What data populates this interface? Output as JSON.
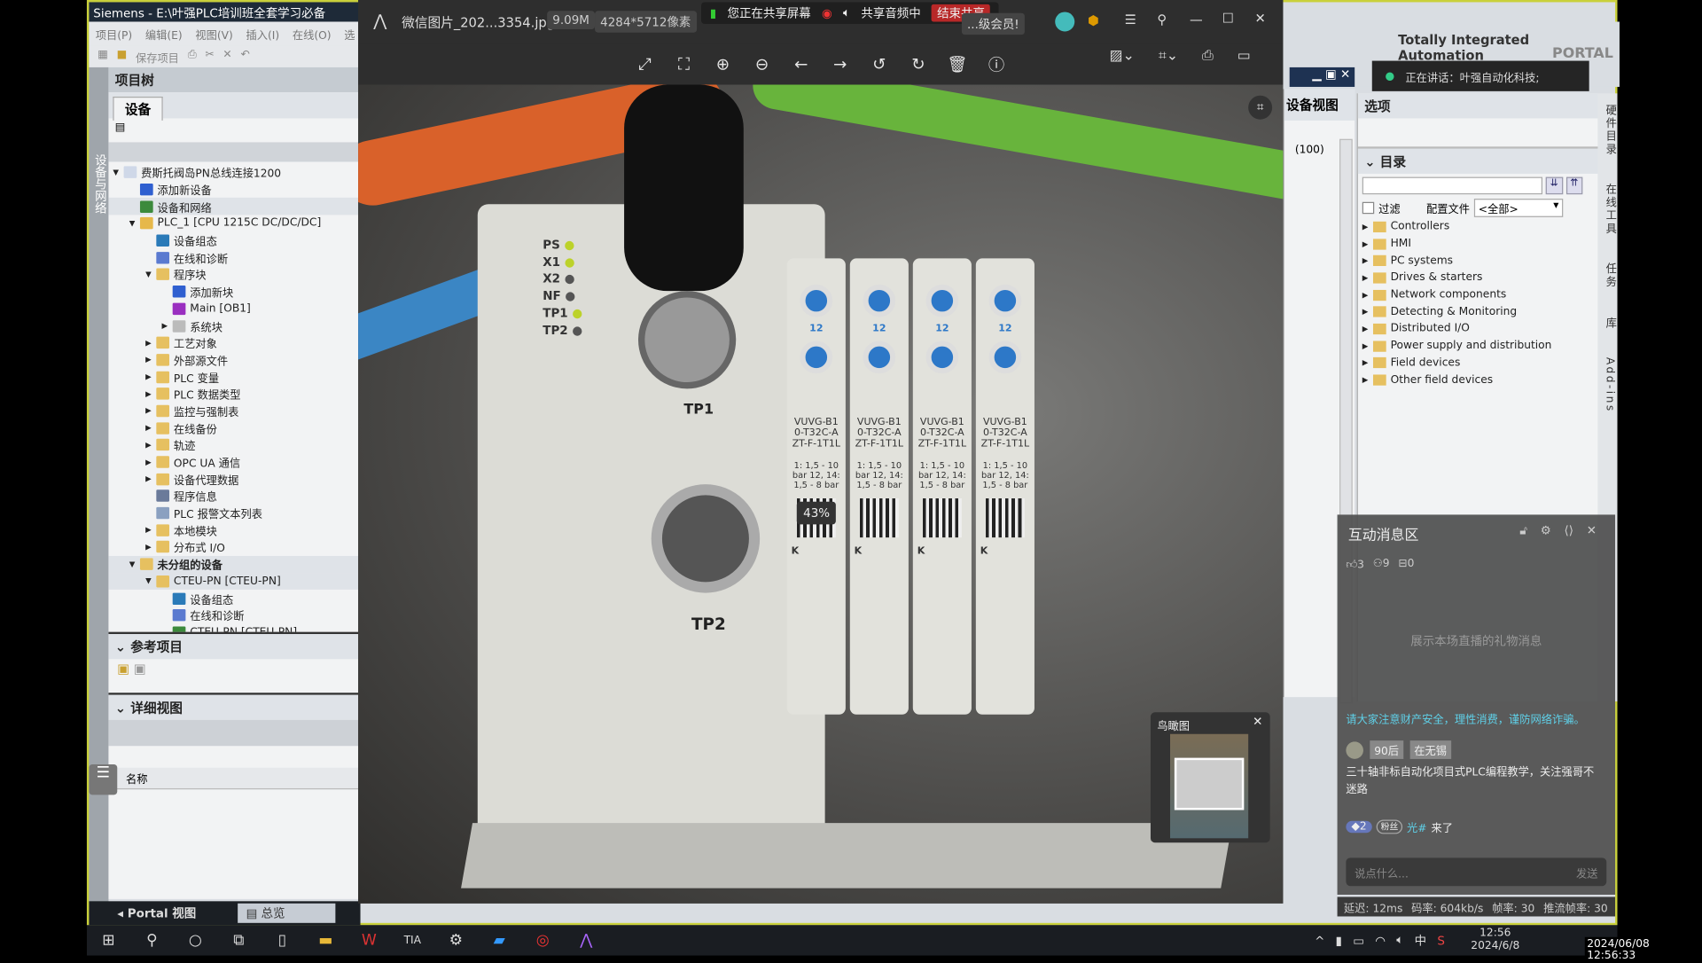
{
  "tia": {
    "window_title": "Siemens - E:\\叶强PLC培训班全套学习必备",
    "menu": [
      "项目(P)",
      "编辑(E)",
      "视图(V)",
      "插入(I)",
      "在线(O)",
      "选"
    ],
    "toolbar_save": "保存项目",
    "left_rail_label": "设备与网络",
    "project_tree_title": "项目树",
    "devices_tab": "设备",
    "tree": [
      {
        "level": 0,
        "arrow": "▼",
        "label": "费斯托阀岛PN总线连接1200",
        "icon": "project-icon",
        "color": "#cfd8e8"
      },
      {
        "level": 1,
        "arrow": "",
        "label": "添加新设备",
        "icon": "add-device-icon",
        "color": "#2f5fd0"
      },
      {
        "level": 1,
        "arrow": "",
        "label": "设备和网络",
        "icon": "network-icon",
        "color": "#3c8a3c",
        "selected": true
      },
      {
        "level": 1,
        "arrow": "▼",
        "label": "PLC_1 [CPU 1215C DC/DC/DC]",
        "icon": "plc-icon",
        "color": "#e6b84a"
      },
      {
        "level": 2,
        "arrow": "",
        "label": "设备组态",
        "icon": "device-config-icon",
        "color": "#2a7ab8"
      },
      {
        "level": 2,
        "arrow": "",
        "label": "在线和诊断",
        "icon": "diagnostics-icon",
        "color": "#5a7ad0"
      },
      {
        "level": 2,
        "arrow": "▼",
        "label": "程序块",
        "icon": "folder-icon",
        "color": "#e6c060"
      },
      {
        "level": 3,
        "arrow": "",
        "label": "添加新块",
        "icon": "add-block-icon",
        "color": "#2f5fd0"
      },
      {
        "level": 3,
        "arrow": "",
        "label": "Main [OB1]",
        "icon": "ob-icon",
        "color": "#9a2fc0"
      },
      {
        "level": 3,
        "arrow": "▶",
        "label": "系统块",
        "icon": "folder-icon",
        "color": "#bbbbbb"
      },
      {
        "level": 2,
        "arrow": "▶",
        "label": "工艺对象",
        "icon": "folder-icon",
        "color": "#e6c060"
      },
      {
        "level": 2,
        "arrow": "▶",
        "label": "外部源文件",
        "icon": "folder-icon",
        "color": "#e6c060"
      },
      {
        "level": 2,
        "arrow": "▶",
        "label": "PLC 变量",
        "icon": "folder-icon",
        "color": "#e6c060"
      },
      {
        "level": 2,
        "arrow": "▶",
        "label": "PLC 数据类型",
        "icon": "folder-icon",
        "color": "#e6c060"
      },
      {
        "level": 2,
        "arrow": "▶",
        "label": "监控与强制表",
        "icon": "folder-icon",
        "color": "#e6c060"
      },
      {
        "level": 2,
        "arrow": "▶",
        "label": "在线备份",
        "icon": "folder-icon",
        "color": "#e6c060"
      },
      {
        "level": 2,
        "arrow": "▶",
        "label": "轨迹",
        "icon": "folder-icon",
        "color": "#e6c060"
      },
      {
        "level": 2,
        "arrow": "▶",
        "label": "OPC UA 通信",
        "icon": "folder-icon",
        "color": "#e6c060"
      },
      {
        "level": 2,
        "arrow": "▶",
        "label": "设备代理数据",
        "icon": "folder-icon",
        "color": "#e6c060"
      },
      {
        "level": 2,
        "arrow": "",
        "label": "程序信息",
        "icon": "program-info-icon",
        "color": "#6a7a9a"
      },
      {
        "level": 2,
        "arrow": "",
        "label": "PLC 报警文本列表",
        "icon": "alarm-text-icon",
        "color": "#8aa0c0"
      },
      {
        "level": 2,
        "arrow": "▶",
        "label": "本地模块",
        "icon": "folder-icon",
        "color": "#e6c060"
      },
      {
        "level": 2,
        "arrow": "▶",
        "label": "分布式 I/O",
        "icon": "folder-icon",
        "color": "#e6c060"
      },
      {
        "level": 1,
        "arrow": "▼",
        "label": "未分组的设备",
        "icon": "ungrouped-icon",
        "color": "#e6c060",
        "bold": true,
        "selected": true
      },
      {
        "level": 2,
        "arrow": "▼",
        "label": "CTEU-PN [CTEU-PN]",
        "icon": "device-icon",
        "color": "#e6c060",
        "selected": true
      },
      {
        "level": 3,
        "arrow": "",
        "label": "设备组态",
        "icon": "device-config-icon",
        "color": "#2a7ab8"
      },
      {
        "level": 3,
        "arrow": "",
        "label": "在线和诊断",
        "icon": "diagnostics-icon",
        "color": "#5a7ad0"
      },
      {
        "level": 3,
        "arrow": "",
        "label": "CTEU-PN [CTEU-PN]",
        "icon": "device-icon",
        "color": "#3c8a3c"
      }
    ],
    "ref_projects_title": "参考项目",
    "detail_view_title": "详细视图",
    "detail_col_name": "名称",
    "portal_view": "Portal 视图",
    "overview_tab": "总览",
    "brand_line1": "Totally Integrated Automation",
    "brand_line2": "PORTAL",
    "device_view_tab": "设备视图",
    "zoom_value": "(100)",
    "tasks": {
      "options_title": "选项",
      "catalog_title": "目录",
      "search_value": "",
      "filter_label": "过滤",
      "profile_label": "配置文件",
      "profile_value": "<全部>",
      "catalog": [
        "Controllers",
        "HMI",
        "PC systems",
        "Drives & starters",
        "Network components",
        "Detecting & Monitoring",
        "Distributed I/O",
        "Power supply and distribution",
        "Field devices",
        "Other field devices"
      ]
    },
    "right_rail": [
      "硬件目录",
      "在线工具",
      "任务",
      "库",
      "Add-ins"
    ]
  },
  "viewer": {
    "file_name": "微信图片_202...3354.jpg",
    "file_size": "9.09M",
    "resolution": "4284*5712像素",
    "zoom_badge": "43%",
    "tools": [
      "fullscreen-icon",
      "fit-icon",
      "zoom-in-icon",
      "zoom-out-icon",
      "prev-icon",
      "next-icon",
      "rotate-left-icon",
      "rotate-right-icon",
      "delete-icon",
      "info-icon"
    ],
    "birdseye_title": "鸟瞰图",
    "photo_labels": {
      "leds": [
        "PS",
        "X1",
        "X2",
        "NF",
        "TP1",
        "TP2"
      ],
      "tp1": "TP1",
      "tp2": "TP2",
      "valve": "VUVG-B10-T32C-AZT-F-1T1L",
      "valve_spec": "1: 1,5 - 10 bar 12, 14: 1,5 - 8 bar",
      "valve_k": "K",
      "valve_num": "12"
    }
  },
  "sharing": {
    "sharing_screen": "您正在共享屏幕",
    "sharing_audio": "共享音频中",
    "end_share": "结束共享",
    "promo": "...级会员!",
    "speaking": "正在讲话：叶强自动化科技;"
  },
  "chat": {
    "title": "互动消息区",
    "likes": "3",
    "viewers": "9",
    "gifts": "0",
    "gift_placeholder": "展示本场直播的礼物消息",
    "notice": "请大家注意财产安全，理性消费，谨防网络诈骗。",
    "user_tags": [
      "90后",
      "在无锡"
    ],
    "message": "三十轴非标自动化项目式PLC编程教学，关注强哥不迷路",
    "join_level": "2",
    "join_badge": "粉丝",
    "join_user": "光#",
    "join_text": "来了",
    "input_placeholder": "说点什么...",
    "send": "发送",
    "accent": "#5fd0e8"
  },
  "stats": {
    "latency": "延迟: 12ms",
    "bitrate": "码率: 604kb/s",
    "fps": "帧率: 30",
    "push_fps": "推流帧率: 30"
  },
  "taskbar": {
    "time": "12:56",
    "date": "2024/6/8",
    "ime": "中",
    "timestamp": "2024/06/08 12:56:33"
  }
}
